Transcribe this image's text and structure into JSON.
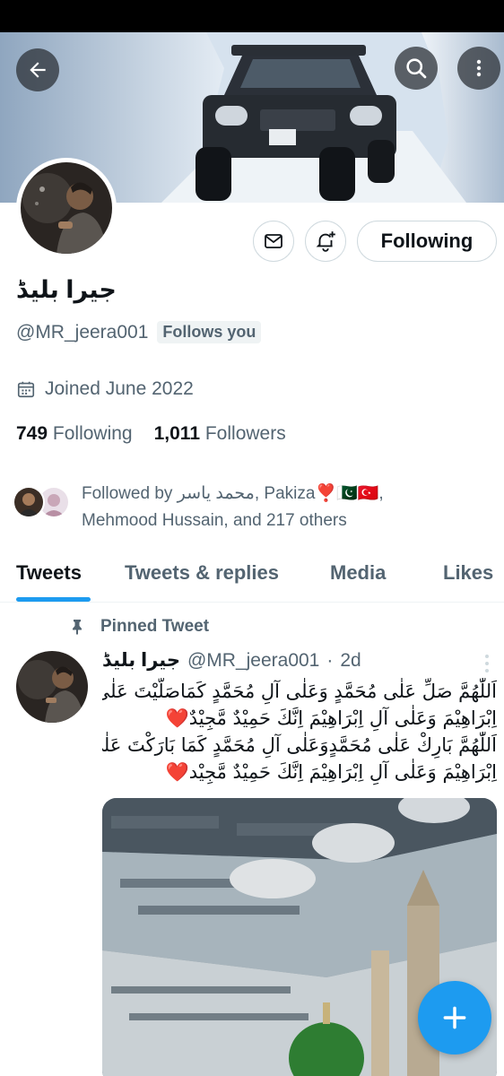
{
  "profile": {
    "display_name": "جیرا بلیڈ",
    "handle": "@MR_jeera001",
    "follows_you": "Follows you",
    "joined": "Joined June 2022",
    "following_count": "749",
    "following_label": "Following",
    "followers_count": "1,011",
    "followers_label": "Followers",
    "follow_state_button": "Following"
  },
  "followed_by": {
    "line1_prefix": "Followed by ",
    "name1": "محمد یاسر",
    "sep": ", ",
    "name2": "Pakiza",
    "emoji": "❣️🇵🇰🇹🇷,",
    "line2": "Mehmood Hussain, and 217 others"
  },
  "tabs": [
    {
      "label": "Tweets",
      "active": true
    },
    {
      "label": "Tweets & replies",
      "active": false
    },
    {
      "label": "Media",
      "active": false
    },
    {
      "label": "Likes",
      "active": false
    }
  ],
  "pinned_tweet": {
    "pinned_label": "Pinned Tweet",
    "author_name": "جیرا بلیڈ",
    "author_handle": "@MR_jeera001",
    "dot": "·",
    "time": "2d",
    "lines": [
      "اَللّٰهُمَّ صَلِّ عَلٰى مُحَمَّدٍ وَعَلٰى آلِ مُحَمَّدٍ كَمَاصَلَّيْتَ عَلٰى",
      "اِبْرَاهِيْمَ وَعَلٰى آلِ اِبْرَاهِيْمَ اِنَّكَ حَمِيْدٌ مَّجِيْدٌ",
      "اَللّٰهُمَّ بَارِكْ عَلٰى مُحَمَّدٍوَعَلٰى آلِ مُحَمَّدٍ كَمَا بَارَكْتَ عَلٰى",
      "اِبْرَاهِيْمَ وَعَلٰى آلِ اِبْرَاهِيْمَ اِنَّكَ حَمِيْدٌ مَّجِيْد"
    ],
    "heart": "❤️"
  },
  "colors": {
    "accent": "#1d9bf0",
    "text_primary": "#0f1419",
    "text_secondary": "#536471"
  },
  "icons": {
    "back": "arrow-left-icon",
    "search": "search-icon",
    "more": "more-vertical-icon",
    "message": "mail-icon",
    "notifications": "bell-plus-icon",
    "calendar": "calendar-icon",
    "pin": "pin-icon",
    "compose": "plus-icon"
  }
}
